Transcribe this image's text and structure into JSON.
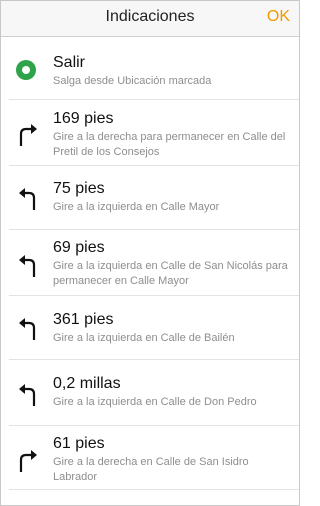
{
  "nav": {
    "title": "Indicaciones",
    "ok_label": "OK"
  },
  "colors": {
    "accent": "#f29900",
    "start_marker": "#2ea34a"
  },
  "steps": [
    {
      "icon": "start-marker-icon",
      "title": "Salir",
      "subtitle": "Salga desde Ubicación marcada"
    },
    {
      "icon": "turn-right-arrow-icon",
      "title": "169 pies",
      "subtitle": "Gire a la derecha para permanecer en Calle del Pretil de los Consejos"
    },
    {
      "icon": "turn-left-arrow-icon",
      "title": "75 pies",
      "subtitle": "Gire a la izquierda en Calle Mayor"
    },
    {
      "icon": "turn-left-arrow-icon",
      "title": "69 pies",
      "subtitle": "Gire a la izquierda en Calle de San Nicolás para permanecer en Calle Mayor"
    },
    {
      "icon": "turn-left-arrow-icon",
      "title": "361 pies",
      "subtitle": "Gire a la izquierda en Calle de Bailén"
    },
    {
      "icon": "turn-left-arrow-icon",
      "title": "0,2 millas",
      "subtitle": "Gire a la izquierda en Calle de Don Pedro"
    },
    {
      "icon": "turn-right-arrow-icon",
      "title": "61 pies",
      "subtitle": "Gire a la derecha en Calle de San Isidro Labrador"
    }
  ]
}
